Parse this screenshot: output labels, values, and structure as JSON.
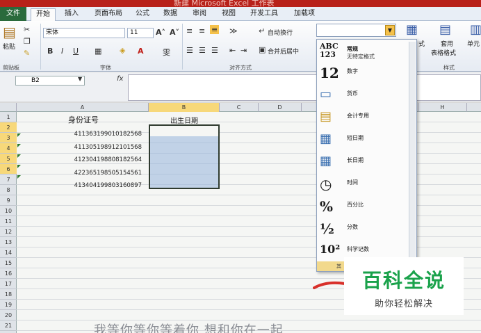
{
  "title_bar": {
    "text": "新建 Microsoft Excel 工作表"
  },
  "tabs": [
    "文件",
    "开始",
    "插入",
    "页面布局",
    "公式",
    "数据",
    "审阅",
    "视图",
    "开发工具",
    "加载项"
  ],
  "ribbon": {
    "paste_label": "粘贴",
    "clipboard_label": "剪贴板",
    "font_name": "宋体",
    "font_size": "11",
    "font_label": "字体",
    "align_label": "对齐方式",
    "wrap_text": "自动换行",
    "merge_center": "合并后居中",
    "styles_label": "样式",
    "table_format_top": "套用",
    "table_format_bottom": "表格格式",
    "cell_style": "单元",
    "cond_format_partial": "式",
    "bold": "B",
    "italic": "I",
    "underline": "U"
  },
  "formula_bar": {
    "name_box": "B2",
    "fx": "fx",
    "value": ""
  },
  "columns": [
    "A",
    "B",
    "C",
    "D",
    "H"
  ],
  "rows": [
    "1",
    "2",
    "3",
    "4",
    "5",
    "6",
    "7",
    "8",
    "9",
    "10",
    "11",
    "12",
    "13",
    "14",
    "15",
    "16",
    "17",
    "18",
    "19",
    "20",
    "21"
  ],
  "sheet": {
    "header_a": "身份证号",
    "header_b": "出生日期",
    "ids": [
      "411363199010182568",
      "411305198912101568",
      "412304198808182564",
      "422365198505154561",
      "413404199803160897"
    ]
  },
  "number_format_dropdown": {
    "items": [
      {
        "icon": "ABC 123",
        "label": "常规",
        "sub": "无特定格式"
      },
      {
        "icon": "12",
        "label": "数字",
        "sub": ""
      },
      {
        "icon": "currency-icon",
        "label": "货币",
        "sub": ""
      },
      {
        "icon": "accounting-icon",
        "label": "会计专用",
        "sub": ""
      },
      {
        "icon": "calendar-icon",
        "label": "短日期",
        "sub": ""
      },
      {
        "icon": "calendar-icon",
        "label": "长日期",
        "sub": ""
      },
      {
        "icon": "clock-icon",
        "label": "时间",
        "sub": ""
      },
      {
        "icon": "%",
        "label": "百分比",
        "sub": ""
      },
      {
        "icon": "½",
        "label": "分数",
        "sub": ""
      },
      {
        "icon": "10²",
        "label": "科学记数",
        "sub": ""
      }
    ],
    "footer": "其"
  },
  "watermark": {
    "brand": "百科全说",
    "tagline": "助你轻松解决"
  },
  "caption": "我等你等你等着你 想和你在一起"
}
